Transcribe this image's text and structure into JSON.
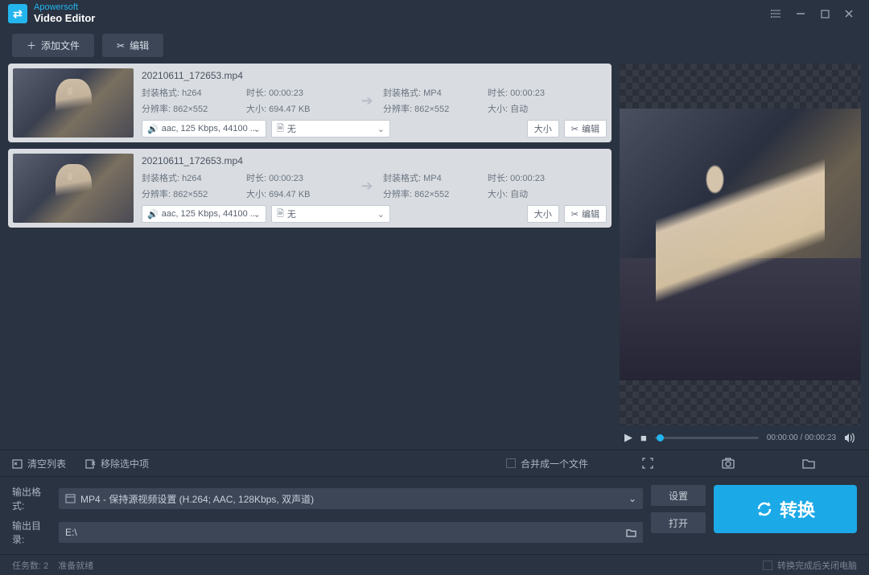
{
  "brand": "Apowersoft",
  "app_name": "Video Editor",
  "toolbar": {
    "add_file": "添加文件",
    "edit": "编辑"
  },
  "files": [
    {
      "name": "20210611_172653.mp4",
      "src": {
        "codec": "封装格式: h264",
        "res": "分辨率: 862×552",
        "dur": "时长: 00:00:23",
        "size": "大小: 694.47 KB"
      },
      "dst": {
        "codec": "封装格式: MP4",
        "res": "分辨率: 862×552",
        "dur": "时长: 00:00:23",
        "size": "大小: 自动"
      },
      "audio_sel": "aac, 125 Kbps, 44100 ...",
      "sub_sel": "无",
      "btn_size": "大小",
      "btn_edit": "编辑"
    },
    {
      "name": "20210611_172653.mp4",
      "src": {
        "codec": "封装格式: h264",
        "res": "分辨率: 862×552",
        "dur": "时长: 00:00:23",
        "size": "大小: 694.47 KB"
      },
      "dst": {
        "codec": "封装格式: MP4",
        "res": "分辨率: 862×552",
        "dur": "时长: 00:00:23",
        "size": "大小: 自动"
      },
      "audio_sel": "aac, 125 Kbps, 44100 ...",
      "sub_sel": "无",
      "btn_size": "大小",
      "btn_edit": "编辑"
    }
  ],
  "player": {
    "time": "00:00:00 / 00:00:23"
  },
  "midbar": {
    "clear": "清空列表",
    "remove": "移除选中项",
    "merge": "合并成一个文件"
  },
  "output": {
    "format_label": "输出格式:",
    "format_value": "MP4 - 保持源视频设置 (H.264; AAC, 128Kbps, 双声道)",
    "dir_label": "输出目录:",
    "dir_value": "E:\\",
    "settings": "设置",
    "open": "打开",
    "convert": "转换"
  },
  "status": {
    "tasks": "任务数: 2",
    "ready": "准备就绪",
    "shutdown": "转换完成后关闭电脑"
  }
}
